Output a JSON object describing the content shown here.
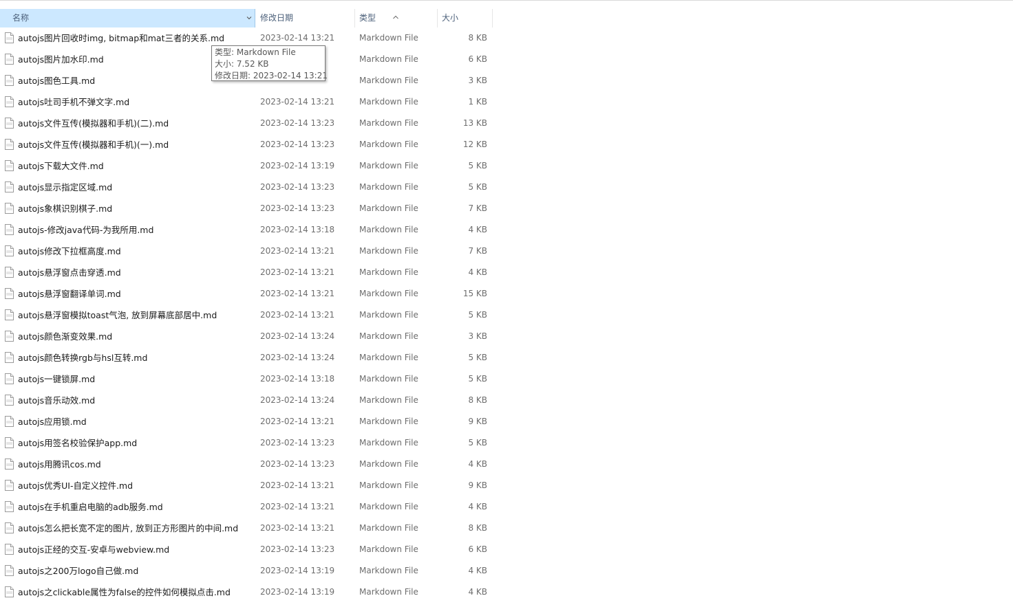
{
  "header": {
    "col_name": "名称",
    "col_date": "修改日期",
    "col_type": "类型",
    "col_size": "大小",
    "sorted_column": "type",
    "chevron_icon": "chevron-down-icon",
    "sort_icon": "sort-ascending-icon"
  },
  "file_icon": "markdown-file-icon",
  "files": [
    {
      "name": "autojs图片回收时img, bitmap和mat三者的关系.md",
      "date": "2023-02-14 13:21",
      "type": "Markdown File",
      "size": "8 KB"
    },
    {
      "name": "autojs图片加水印.md",
      "date": "",
      "type": "Markdown File",
      "size": "6 KB"
    },
    {
      "name": "autojs图色工具.md",
      "date": "",
      "type": "Markdown File",
      "size": "3 KB"
    },
    {
      "name": "autojs吐司手机不弹文字.md",
      "date": "2023-02-14 13:21",
      "type": "Markdown File",
      "size": "1 KB"
    },
    {
      "name": "autojs文件互传(模拟器和手机)(二).md",
      "date": "2023-02-14 13:23",
      "type": "Markdown File",
      "size": "13 KB"
    },
    {
      "name": "autojs文件互传(模拟器和手机)(一).md",
      "date": "2023-02-14 13:23",
      "type": "Markdown File",
      "size": "12 KB"
    },
    {
      "name": "autojs下载大文件.md",
      "date": "2023-02-14 13:19",
      "type": "Markdown File",
      "size": "5 KB"
    },
    {
      "name": "autojs显示指定区域.md",
      "date": "2023-02-14 13:23",
      "type": "Markdown File",
      "size": "5 KB"
    },
    {
      "name": "autojs象棋识别棋子.md",
      "date": "2023-02-14 13:23",
      "type": "Markdown File",
      "size": "7 KB"
    },
    {
      "name": "autojs-修改java代码-为我所用.md",
      "date": "2023-02-14 13:18",
      "type": "Markdown File",
      "size": "4 KB"
    },
    {
      "name": "autojs修改下拉框高度.md",
      "date": "2023-02-14 13:21",
      "type": "Markdown File",
      "size": "7 KB"
    },
    {
      "name": "autojs悬浮窗点击穿透.md",
      "date": "2023-02-14 13:21",
      "type": "Markdown File",
      "size": "4 KB"
    },
    {
      "name": "autojs悬浮窗翻译单词.md",
      "date": "2023-02-14 13:21",
      "type": "Markdown File",
      "size": "15 KB"
    },
    {
      "name": "autojs悬浮窗模拟toast气泡, 放到屏幕底部居中.md",
      "date": "2023-02-14 13:21",
      "type": "Markdown File",
      "size": "5 KB"
    },
    {
      "name": "autojs颜色渐变效果.md",
      "date": "2023-02-14 13:24",
      "type": "Markdown File",
      "size": "3 KB"
    },
    {
      "name": "autojs颜色转换rgb与hsl互转.md",
      "date": "2023-02-14 13:24",
      "type": "Markdown File",
      "size": "5 KB"
    },
    {
      "name": "autojs一键锁屏.md",
      "date": "2023-02-14 13:18",
      "type": "Markdown File",
      "size": "5 KB"
    },
    {
      "name": "autojs音乐动效.md",
      "date": "2023-02-14 13:24",
      "type": "Markdown File",
      "size": "8 KB"
    },
    {
      "name": "autojs应用锁.md",
      "date": "2023-02-14 13:21",
      "type": "Markdown File",
      "size": "9 KB"
    },
    {
      "name": "autojs用签名校验保护app.md",
      "date": "2023-02-14 13:23",
      "type": "Markdown File",
      "size": "5 KB"
    },
    {
      "name": "autojs用腾讯cos.md",
      "date": "2023-02-14 13:23",
      "type": "Markdown File",
      "size": "4 KB"
    },
    {
      "name": "autojs优秀UI-自定义控件.md",
      "date": "2023-02-14 13:21",
      "type": "Markdown File",
      "size": "9 KB"
    },
    {
      "name": "autojs在手机重启电脑的adb服务.md",
      "date": "2023-02-14 13:21",
      "type": "Markdown File",
      "size": "4 KB"
    },
    {
      "name": "autojs怎么把长宽不定的图片, 放到正方形图片的中间.md",
      "date": "2023-02-14 13:21",
      "type": "Markdown File",
      "size": "8 KB"
    },
    {
      "name": "autojs正经的交互-安卓与webview.md",
      "date": "2023-02-14 13:23",
      "type": "Markdown File",
      "size": "6 KB"
    },
    {
      "name": "autojs之200万logo自己做.md",
      "date": "2023-02-14 13:19",
      "type": "Markdown File",
      "size": "4 KB"
    },
    {
      "name": "autojs之clickable属性为false的控件如何模拟点击.md",
      "date": "2023-02-14 13:19",
      "type": "Markdown File",
      "size": "4 KB"
    }
  ],
  "tooltip": {
    "type_line": "类型: Markdown File",
    "size_line": "大小: 7.52 KB",
    "date_line": "修改日期: 2023-02-14 13:21"
  }
}
